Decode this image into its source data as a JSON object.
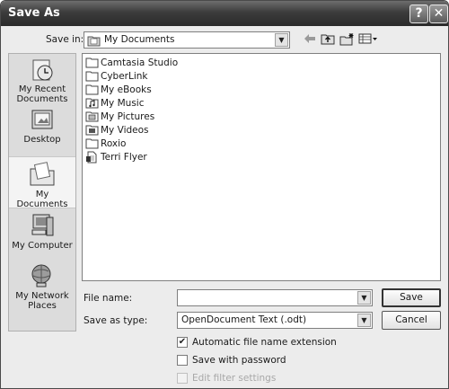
{
  "window": {
    "title": "Save As",
    "help_glyph": "?",
    "close_glyph": "✕"
  },
  "save_in": {
    "label": "Save in:",
    "value": "My Documents"
  },
  "toolbar": {
    "icons": [
      "back-arrow-icon",
      "up-folder-icon",
      "new-folder-icon",
      "view-menu-icon"
    ]
  },
  "places": [
    {
      "label_line1": "My Recent",
      "label_line2": "Documents",
      "icon": "recent-documents-icon"
    },
    {
      "label_line1": "Desktop",
      "label_line2": "",
      "icon": "desktop-icon"
    },
    {
      "label_line1": "My Documents",
      "label_line2": "",
      "icon": "my-documents-icon",
      "selected": true
    },
    {
      "label_line1": "My Computer",
      "label_line2": "",
      "icon": "computer-icon"
    },
    {
      "label_line1": "My Network",
      "label_line2": "Places",
      "icon": "network-icon"
    }
  ],
  "files": [
    {
      "name": "Camtasia Studio",
      "icon": "folder-icon"
    },
    {
      "name": "CyberLink",
      "icon": "folder-icon"
    },
    {
      "name": "My eBooks",
      "icon": "folder-icon"
    },
    {
      "name": "My Music",
      "icon": "music-folder-icon"
    },
    {
      "name": "My Pictures",
      "icon": "pictures-folder-icon"
    },
    {
      "name": "My Videos",
      "icon": "videos-folder-icon"
    },
    {
      "name": "Roxio",
      "icon": "folder-icon"
    },
    {
      "name": "Terri Flyer",
      "icon": "document-icon"
    }
  ],
  "file_name": {
    "label": "File name:",
    "value": ""
  },
  "save_as_type": {
    "label": "Save as type:",
    "value": "OpenDocument Text (.odt)"
  },
  "buttons": {
    "save": "Save",
    "cancel": "Cancel"
  },
  "options": [
    {
      "label": "Automatic file name extension",
      "checked": true,
      "enabled": true
    },
    {
      "label": "Save with password",
      "checked": false,
      "enabled": true
    },
    {
      "label": "Edit filter settings",
      "checked": false,
      "enabled": false
    }
  ]
}
